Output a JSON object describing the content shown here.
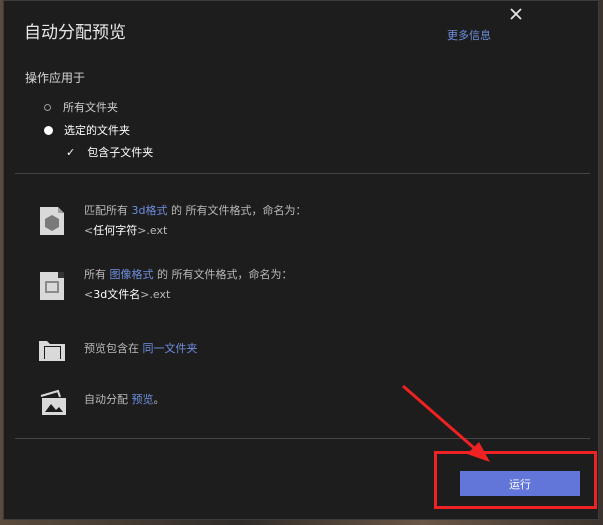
{
  "dialog": {
    "title": "自动分配预览",
    "more_info": "更多信息",
    "section_label": "操作应用于",
    "options": [
      {
        "label": "所有文件夹",
        "selected": false
      },
      {
        "label": "选定的文件夹",
        "selected": true
      }
    ],
    "include_subfolders": {
      "label": "包含子文件夹",
      "checked": true
    },
    "rules": [
      {
        "icon": "3d-file-icon",
        "line1_prefix": "匹配所有 ",
        "line1_link": "3d格式",
        "line1_suffix": " 的 所有文件格式，命名为：",
        "line2_lt": "<",
        "line2_bold": "任何字符",
        "line2_suffix": ">.ext"
      },
      {
        "icon": "image-file-icon",
        "line1_prefix": "所有 ",
        "line1_link": "图像格式",
        "line1_suffix": " 的 所有文件格式，命名为：",
        "line2_lt": "<",
        "line2_bold": "3d文件名",
        "line2_suffix": ">.ext"
      },
      {
        "icon": "folder-icon",
        "text_prefix": "预览包含在 ",
        "text_link": "同一文件夹"
      },
      {
        "icon": "preview-image-icon",
        "text_prefix": "自动分配 ",
        "text_link": "预览",
        "text_suffix": "。"
      }
    ],
    "run_label": "运行"
  },
  "colors": {
    "accent": "#6275d8",
    "link": "#6f8fe0",
    "annotation": "#ee2222"
  }
}
